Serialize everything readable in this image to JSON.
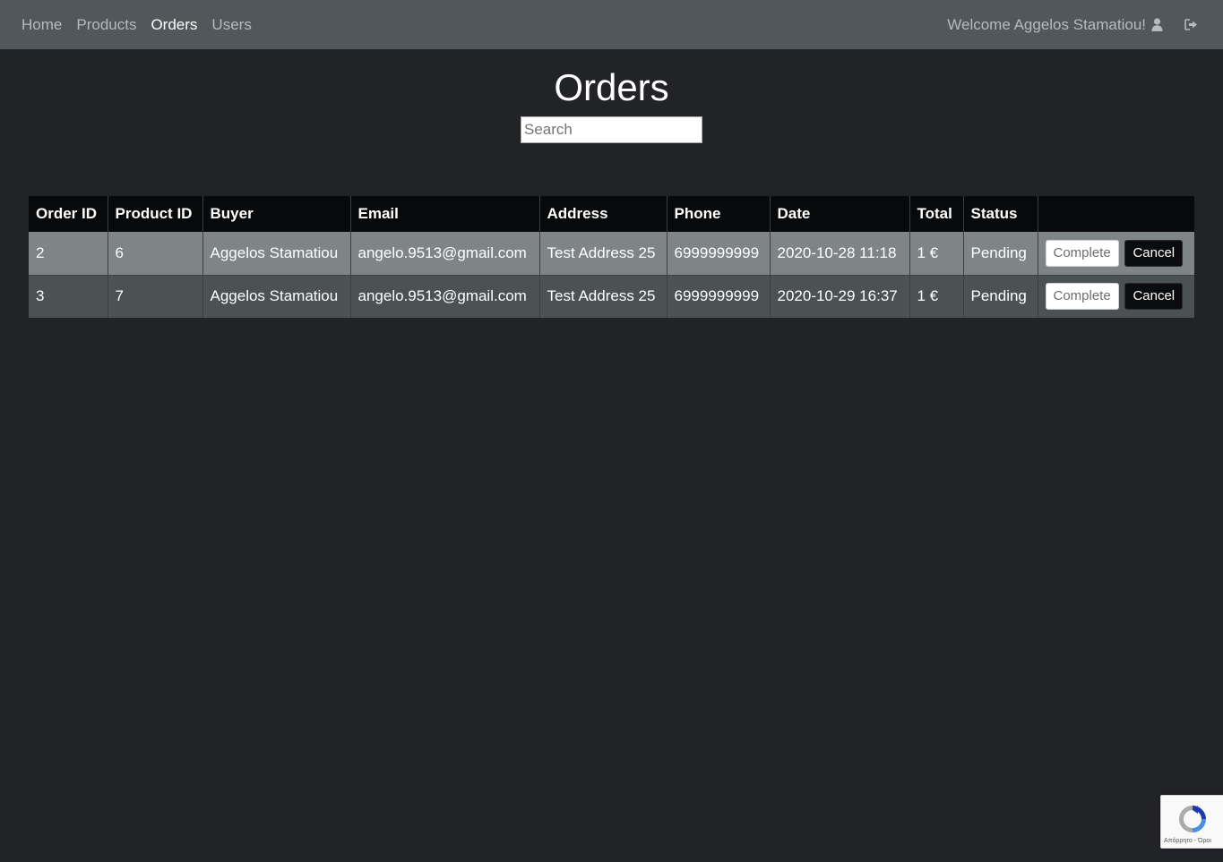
{
  "nav": {
    "links": [
      {
        "label": "Home",
        "active": false
      },
      {
        "label": "Products",
        "active": false
      },
      {
        "label": "Orders",
        "active": true
      },
      {
        "label": "Users",
        "active": false
      }
    ],
    "welcome": "Welcome Aggelos Stamatiou!",
    "user_icon": "user-icon",
    "logout_icon": "sign-out-icon"
  },
  "page": {
    "title": "Orders",
    "search_placeholder": "Search"
  },
  "table": {
    "headers": [
      "Order ID",
      "Product ID",
      "Buyer",
      "Email",
      "Address",
      "Phone",
      "Date",
      "Total",
      "Status",
      ""
    ],
    "rows": [
      {
        "order_id": "2",
        "product_id": "6",
        "buyer": "Aggelos Stamatiou",
        "email": "angelo.9513@gmail.com",
        "address": "Test Address 25",
        "phone": "6999999999",
        "date": "2020-10-28 11:18",
        "total": "1 €",
        "status": "Pending",
        "complete_label": "Complete",
        "cancel_label": "Cancel"
      },
      {
        "order_id": "3",
        "product_id": "7",
        "buyer": "Aggelos Stamatiou",
        "email": "angelo.9513@gmail.com",
        "address": "Test Address 25",
        "phone": "6999999999",
        "date": "2020-10-29 16:37",
        "total": "1 €",
        "status": "Pending",
        "complete_label": "Complete",
        "cancel_label": "Cancel"
      }
    ]
  },
  "recaptcha": {
    "text": "Απόρρητο - Όροι",
    "icon": "recaptcha-icon"
  },
  "colors": {
    "navbar": "#52575b",
    "background": "#222327",
    "header_row": "#08090a",
    "row_odd": "#7f8587",
    "row_even": "#4c5154"
  }
}
